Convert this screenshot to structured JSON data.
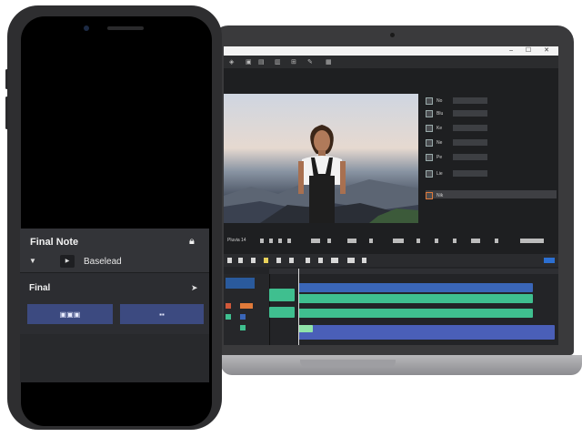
{
  "laptop": {
    "window_controls": "–  ☐  ✕",
    "toolbar_icons": [
      "◈",
      "▣",
      "▤",
      "▥",
      "⊞",
      "✎",
      "▦",
      "◧",
      "⊡"
    ],
    "properties": [
      {
        "label": "No",
        "value": "",
        "icon": "square-icon"
      },
      {
        "label": "Blu",
        "value": "",
        "icon": "square-icon"
      },
      {
        "label": "Ke",
        "value": "",
        "icon": "square-icon"
      },
      {
        "label": "Ne",
        "value": "",
        "icon": "square-icon"
      },
      {
        "label": "Pe",
        "value": "",
        "icon": "square-icon"
      },
      {
        "label": "Lie",
        "value": "",
        "icon": "square-icon"
      },
      {
        "label": "Nik",
        "value": "",
        "icon": "square-icon"
      }
    ],
    "controls_left": "Pluvia 14",
    "tracks": {
      "colors": {
        "blue": "#3a66b8",
        "green": "#3fbf8f",
        "purple": "#4a5fb8",
        "red": "#d0583a",
        "orange": "#e07a3a"
      }
    }
  },
  "phone_sheet": {
    "title": "Final Note",
    "subtitle": "Baselead",
    "chip": "▶",
    "section_label": "Final",
    "button_left": "▣▣▣",
    "button_right": "▪▪"
  }
}
